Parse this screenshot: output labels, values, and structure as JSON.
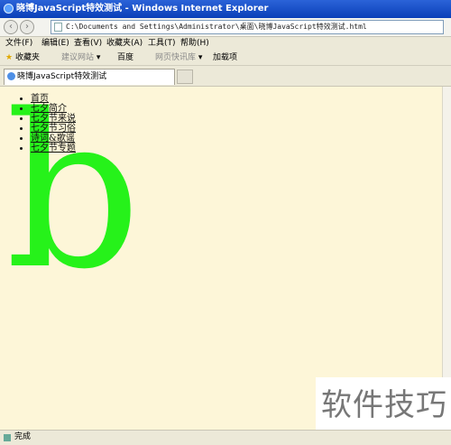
{
  "window": {
    "title": "晓博JavaScript特效测试 - Windows Internet Explorer"
  },
  "address": {
    "value": "C:\\Documents and Settings\\Administrator\\桌面\\晓博JavaScript特效测试.html"
  },
  "menu": [
    "文件(F)",
    "编辑(E)",
    "查看(V)",
    "收藏夹(A)",
    "工具(T)",
    "帮助(H)"
  ],
  "favorites": {
    "label": "收藏夹",
    "items": [
      "建议网站",
      "百度",
      "网页快讯库",
      "加载项"
    ]
  },
  "tab": {
    "label": "晓博JavaScript特效测试"
  },
  "page": {
    "big_letter": "b",
    "nav_items": [
      "首页",
      "七夕简介",
      "七夕节来说",
      "七夕节习俗",
      "诗词&歌谣",
      "七夕节专题"
    ]
  },
  "status": {
    "text": "完成"
  },
  "watermark": {
    "text": "软件技巧"
  }
}
